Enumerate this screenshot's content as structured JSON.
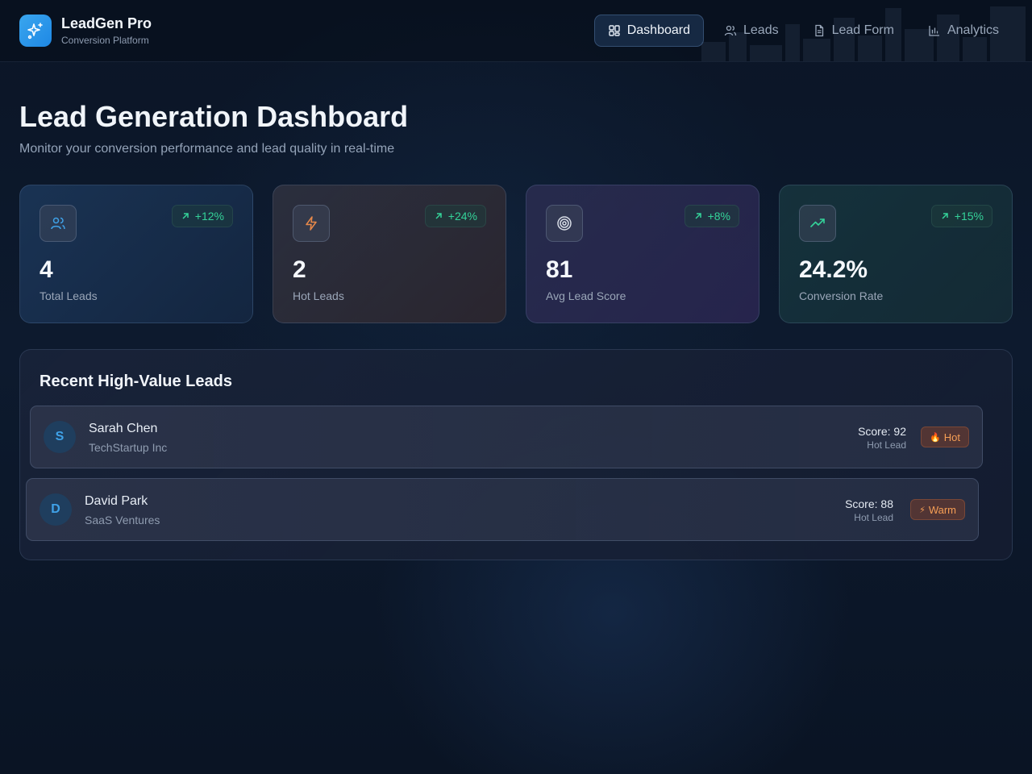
{
  "app": {
    "name": "LeadGen Pro",
    "subtitle": "Conversion Platform"
  },
  "nav": {
    "items": [
      {
        "label": "Dashboard",
        "icon": "grid-icon",
        "active": true
      },
      {
        "label": "Leads",
        "icon": "users-icon",
        "active": false
      },
      {
        "label": "Lead Form",
        "icon": "document-icon",
        "active": false
      },
      {
        "label": "Analytics",
        "icon": "bar-chart-icon",
        "active": false
      }
    ]
  },
  "page": {
    "title": "Lead Generation Dashboard",
    "subtitle": "Monitor your conversion performance and lead quality in real-time"
  },
  "stats": [
    {
      "value": "4",
      "label": "Total Leads",
      "trend": "+12%",
      "icon": "users-icon",
      "icon_color": "#3fa2e8"
    },
    {
      "value": "2",
      "label": "Hot Leads",
      "trend": "+24%",
      "icon": "lightning-icon",
      "icon_color": "#e8894a"
    },
    {
      "value": "81",
      "label": "Avg Lead Score",
      "trend": "+8%",
      "icon": "target-icon",
      "icon_color": "#d8dde6"
    },
    {
      "value": "24.2%",
      "label": "Conversion Rate",
      "trend": "+15%",
      "icon": "trending-up-icon",
      "icon_color": "#34d399"
    }
  ],
  "recent": {
    "title": "Recent High-Value Leads",
    "leads": [
      {
        "initial": "S",
        "name": "Sarah Chen",
        "company": "TechStartup Inc",
        "score": "Score: 92",
        "quality": "Hot Lead",
        "badge": "Hot",
        "badge_icon": "🔥"
      },
      {
        "initial": "D",
        "name": "David Park",
        "company": "SaaS Ventures",
        "score": "Score: 88",
        "quality": "Hot Lead",
        "badge": "Warm",
        "badge_icon": "⚡"
      }
    ]
  },
  "colors": {
    "accent": "#1e88e5",
    "trend_positive": "#34d399",
    "badge_text": "#f59e55"
  }
}
